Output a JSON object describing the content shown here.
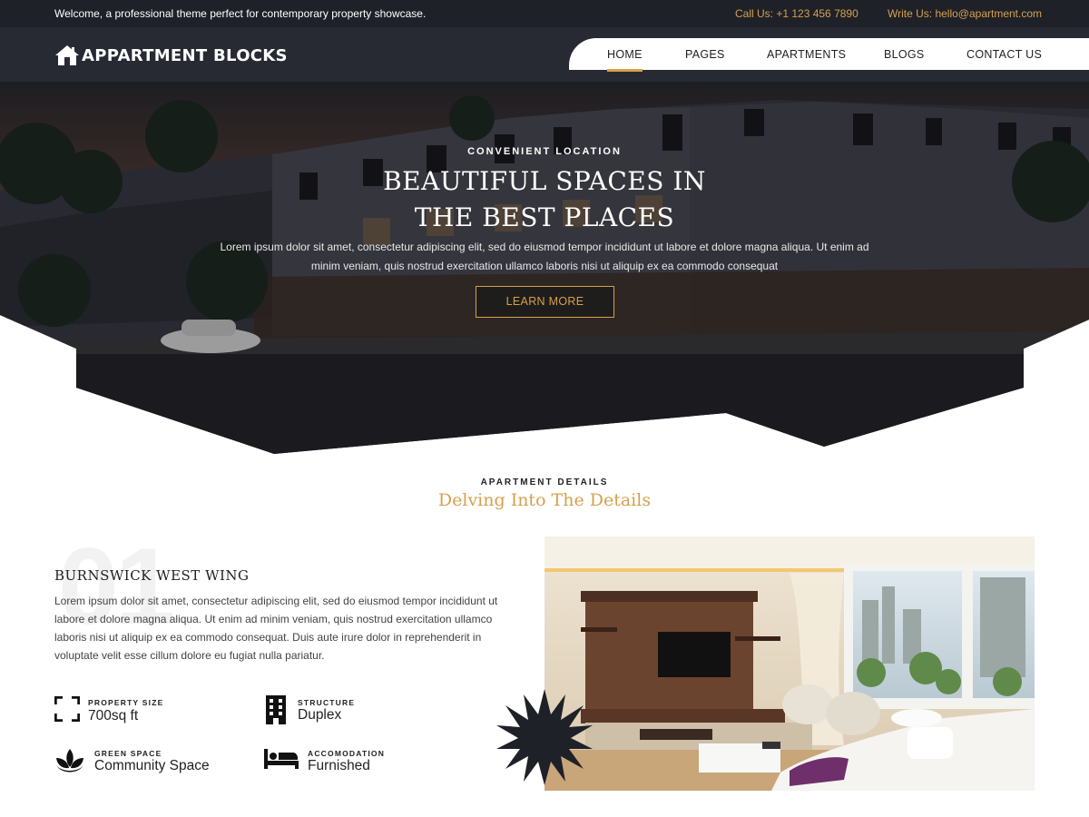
{
  "topbar": {
    "welcome": "Welcome, a professional theme perfect for contemporary property showcase.",
    "call": "Call Us: +1 123 456 7890",
    "write": "Write Us: hello@apartment.com"
  },
  "header": {
    "brand": "APPARTMENT BLOCKS",
    "nav": [
      {
        "label": "HOME",
        "active": true
      },
      {
        "label": "PAGES"
      },
      {
        "label": "APARTMENTS"
      },
      {
        "label": "BLOGS"
      },
      {
        "label": "CONTACT US"
      }
    ]
  },
  "hero": {
    "eyebrow": "CONVENIENT LOCATION",
    "title_line1": "BEAUTIFUL SPACES IN",
    "title_line2": "THE BEST PLACES",
    "text": "Lorem ipsum dolor sit amet, consectetur adipiscing elit, sed do eiusmod tempor incididunt ut labore et dolore magna aliqua. Ut enim ad minim veniam, quis nostrud exercitation ullamco laboris nisi ut aliquip ex ea commodo consequat",
    "button": "LEARN MORE"
  },
  "details": {
    "eyebrow": "APARTMENT DETAILS",
    "title": "Delving Into The Details",
    "number": "01",
    "wing_title": "BURNSWICK WEST WING",
    "wing_text": "Lorem ipsum dolor sit amet, consectetur adipiscing elit, sed do eiusmod tempor incididunt ut labore et dolore magna aliqua. Ut enim ad minim veniam, quis nostrud exercitation ullamco laboris nisi ut aliquip ex ea commodo consequat. Duis aute irure dolor in reprehenderit in voluptate velit esse cillum dolore eu fugiat nulla pariatur.",
    "features": [
      {
        "label": "PROPERTY SIZE",
        "value": "700sq ft",
        "icon": "expand-icon"
      },
      {
        "label": "STRUCTURE",
        "value": "Duplex",
        "icon": "building-icon"
      },
      {
        "label": "GREEN SPACE",
        "value": "Community Space",
        "icon": "lotus-icon"
      },
      {
        "label": "ACCOMODATION",
        "value": "Furnished",
        "icon": "bed-icon"
      }
    ]
  },
  "colors": {
    "accent": "#d6a04d",
    "dark": "#1f2128",
    "header": "#272a33"
  }
}
